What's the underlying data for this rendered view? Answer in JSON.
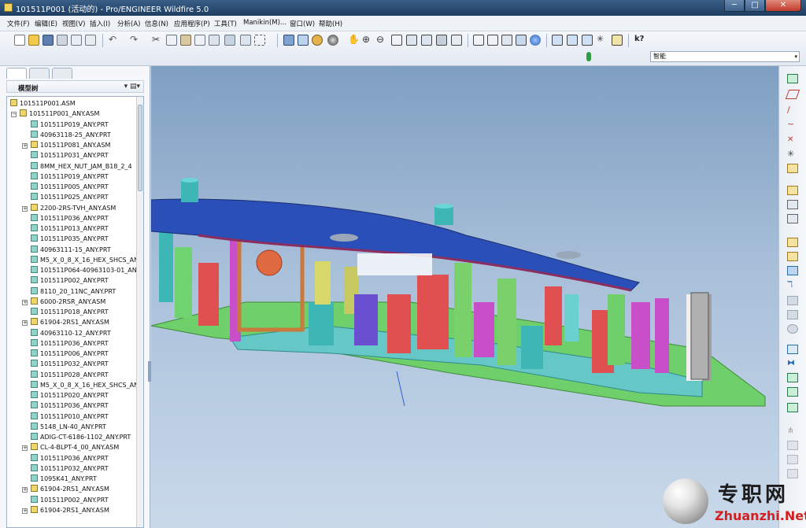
{
  "window": {
    "title": "101511P001 (活动的) - Pro/ENGINEER Wildfire 5.0",
    "minimize_label": "─",
    "maximize_label": "□",
    "close_label": "✕"
  },
  "menubar": {
    "items": [
      {
        "label": "文件(F)"
      },
      {
        "label": "编辑(E)"
      },
      {
        "label": "视图(V)"
      },
      {
        "label": "插入(I)"
      },
      {
        "label": "分析(A)"
      },
      {
        "label": "信息(N)"
      },
      {
        "label": "应用程序(P)"
      },
      {
        "label": "工具(T)"
      },
      {
        "label": "Manikin(M)..."
      },
      {
        "label": "窗口(W)"
      },
      {
        "label": "帮助(H)"
      }
    ]
  },
  "toolbar": {
    "filter_value": "智能",
    "filter_arrow": "▾"
  },
  "model_tree": {
    "title": "模型树",
    "tools_label": "▾ ▤▾",
    "rows": [
      {
        "label": "101511P001.ASM",
        "type": "asm",
        "level": 0,
        "expander": ""
      },
      {
        "label": "101511P001_ANY.ASM",
        "type": "asm",
        "level": 1,
        "expander": "−"
      },
      {
        "label": "101511P019_ANY.PRT",
        "type": "prt",
        "level": 2,
        "expander": ""
      },
      {
        "label": "40963118-25_ANY.PRT",
        "type": "prt",
        "level": 2,
        "expander": ""
      },
      {
        "label": "101511P081_ANY.ASM",
        "type": "asm",
        "level": 2,
        "expander": "+"
      },
      {
        "label": "101511P031_ANY.PRT",
        "type": "prt",
        "level": 2,
        "expander": ""
      },
      {
        "label": "8MM_HEX_NUT_JAM_B18_2_4",
        "type": "prt",
        "level": 2,
        "expander": ""
      },
      {
        "label": "101511P019_ANY.PRT",
        "type": "prt",
        "level": 2,
        "expander": ""
      },
      {
        "label": "101511P005_ANY.PRT",
        "type": "prt",
        "level": 2,
        "expander": ""
      },
      {
        "label": "101511P025_ANY.PRT",
        "type": "prt",
        "level": 2,
        "expander": ""
      },
      {
        "label": "2200-2RS-TVH_ANY.ASM",
        "type": "asm",
        "level": 2,
        "expander": "+"
      },
      {
        "label": "101511P036_ANY.PRT",
        "type": "prt",
        "level": 2,
        "expander": ""
      },
      {
        "label": "101511P013_ANY.PRT",
        "type": "prt",
        "level": 2,
        "expander": ""
      },
      {
        "label": "101511P035_ANY.PRT",
        "type": "prt",
        "level": 2,
        "expander": ""
      },
      {
        "label": "40963111-15_ANY.PRT",
        "type": "prt",
        "level": 2,
        "expander": ""
      },
      {
        "label": "M5_X_0_8_X_16_HEX_SHCS_AN",
        "type": "prt",
        "level": 2,
        "expander": ""
      },
      {
        "label": "101511P064-40963103-01_AN",
        "type": "prt",
        "level": 2,
        "expander": ""
      },
      {
        "label": "101511P002_ANY.PRT",
        "type": "prt",
        "level": 2,
        "expander": ""
      },
      {
        "label": "8110_20_11NC_ANY.PRT",
        "type": "prt",
        "level": 2,
        "expander": ""
      },
      {
        "label": "6000-2RSR_ANY.ASM",
        "type": "asm",
        "level": 2,
        "expander": "+"
      },
      {
        "label": "101511P018_ANY.PRT",
        "type": "prt",
        "level": 2,
        "expander": ""
      },
      {
        "label": "61904-2RS1_ANY.ASM",
        "type": "asm",
        "level": 2,
        "expander": "+"
      },
      {
        "label": "40963110-12_ANY.PRT",
        "type": "prt",
        "level": 2,
        "expander": ""
      },
      {
        "label": "101511P036_ANY.PRT",
        "type": "prt",
        "level": 2,
        "expander": ""
      },
      {
        "label": "101511P006_ANY.PRT",
        "type": "prt",
        "level": 2,
        "expander": ""
      },
      {
        "label": "101511P032_ANY.PRT",
        "type": "prt",
        "level": 2,
        "expander": ""
      },
      {
        "label": "101511P028_ANY.PRT",
        "type": "prt",
        "level": 2,
        "expander": ""
      },
      {
        "label": "M5_X_0_8_X_16_HEX_SHCS_AN",
        "type": "prt",
        "level": 2,
        "expander": ""
      },
      {
        "label": "101511P020_ANY.PRT",
        "type": "prt",
        "level": 2,
        "expander": ""
      },
      {
        "label": "101511P036_ANY.PRT",
        "type": "prt",
        "level": 2,
        "expander": ""
      },
      {
        "label": "101511P010_ANY.PRT",
        "type": "prt",
        "level": 2,
        "expander": ""
      },
      {
        "label": "5148_LN-40_ANY.PRT",
        "type": "prt",
        "level": 2,
        "expander": ""
      },
      {
        "label": "ADIG-CT-6186-1102_ANY.PRT",
        "type": "prt",
        "level": 2,
        "expander": ""
      },
      {
        "label": "CL-4-BLPT-4_00_ANY.ASM",
        "type": "asm",
        "level": 2,
        "expander": "+"
      },
      {
        "label": "101511P036_ANY.PRT",
        "type": "prt",
        "level": 2,
        "expander": ""
      },
      {
        "label": "101511P032_ANY.PRT",
        "type": "prt",
        "level": 2,
        "expander": ""
      },
      {
        "label": "1095K41_ANY.PRT",
        "type": "prt",
        "level": 2,
        "expander": ""
      },
      {
        "label": "61904-2RS1_ANY.ASM",
        "type": "asm",
        "level": 2,
        "expander": "+"
      },
      {
        "label": "101511P002_ANY.PRT",
        "type": "prt",
        "level": 2,
        "expander": ""
      },
      {
        "label": "61904-2RS1_ANY.ASM",
        "type": "asm",
        "level": 2,
        "expander": "+"
      }
    ]
  },
  "watermark": {
    "cn_text": "专职网",
    "en_text": "Zhuanzhi.Net"
  },
  "colors": {
    "titlebar": "#284a70",
    "viewport_top": "#7f9fc2",
    "viewport_bottom": "#c9d9ea",
    "plate_blue": "#2b4fb8",
    "base_green": "#6fcf6a",
    "watermark_red": "#d62020"
  }
}
